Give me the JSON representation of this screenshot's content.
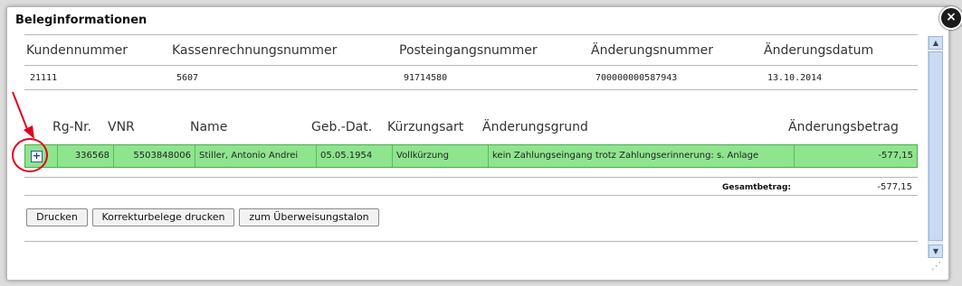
{
  "dialog": {
    "title": "Beleginformationen",
    "close_glyph": "×"
  },
  "info_table": {
    "headers": [
      "Kundennummer",
      "Kassenrechnungsnummer",
      "Posteingangsnummer",
      "Änderungsnummer",
      "Änderungsdatum"
    ],
    "values": [
      "21111",
      "5607",
      "91714580",
      "700000000587943",
      "13.10.2014"
    ]
  },
  "main_table": {
    "headers": [
      "Rg-Nr.",
      "VNR",
      "Name",
      "Geb.-Dat.",
      "Kürzungsart",
      "Änderungsgrund",
      "Änderungsbetrag"
    ],
    "rows": [
      {
        "expand_glyph": "+",
        "cells": [
          "336568",
          "5503848006",
          "Stiller, Antonio Andrei",
          "05.05.1954",
          "Vollkürzung",
          "kein Zahlungseingang trotz Zahlungserinnerung: s. Anlage",
          "-577,15"
        ]
      }
    ],
    "total_label": "Gesamtbetrag:",
    "total_value": "-577,15"
  },
  "buttons": {
    "print": "Drucken",
    "print_corrections": "Korrekturbelege drucken",
    "transfer_slip": "zum Überweisungstalon"
  },
  "colors": {
    "row_highlight": "#8ee58e",
    "annotation_red": "#e0001a"
  },
  "icons": [
    "close-icon",
    "expand-plus-icon",
    "scroll-up-icon",
    "scroll-down-icon",
    "resize-grip-icon"
  ]
}
